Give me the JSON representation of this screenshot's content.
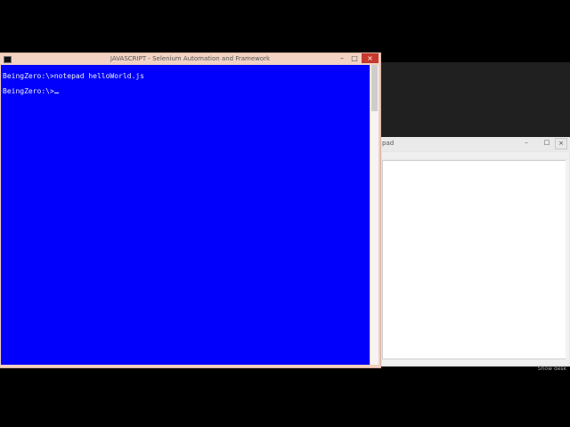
{
  "cmd": {
    "title": "JAVASCRIPT - Selenium Automation and Framework",
    "controls": {
      "minimize": "–",
      "maximize": "□",
      "close": "×"
    },
    "lines": [
      "BeingZero:\\>notepad helloWorld.js",
      "BeingZero:\\>"
    ]
  },
  "notepad": {
    "title_fragment": "pad",
    "controls": {
      "minimize": "–",
      "maximize": "□",
      "close": "×"
    }
  },
  "desktop": {
    "bottom_text": "Show desk"
  }
}
